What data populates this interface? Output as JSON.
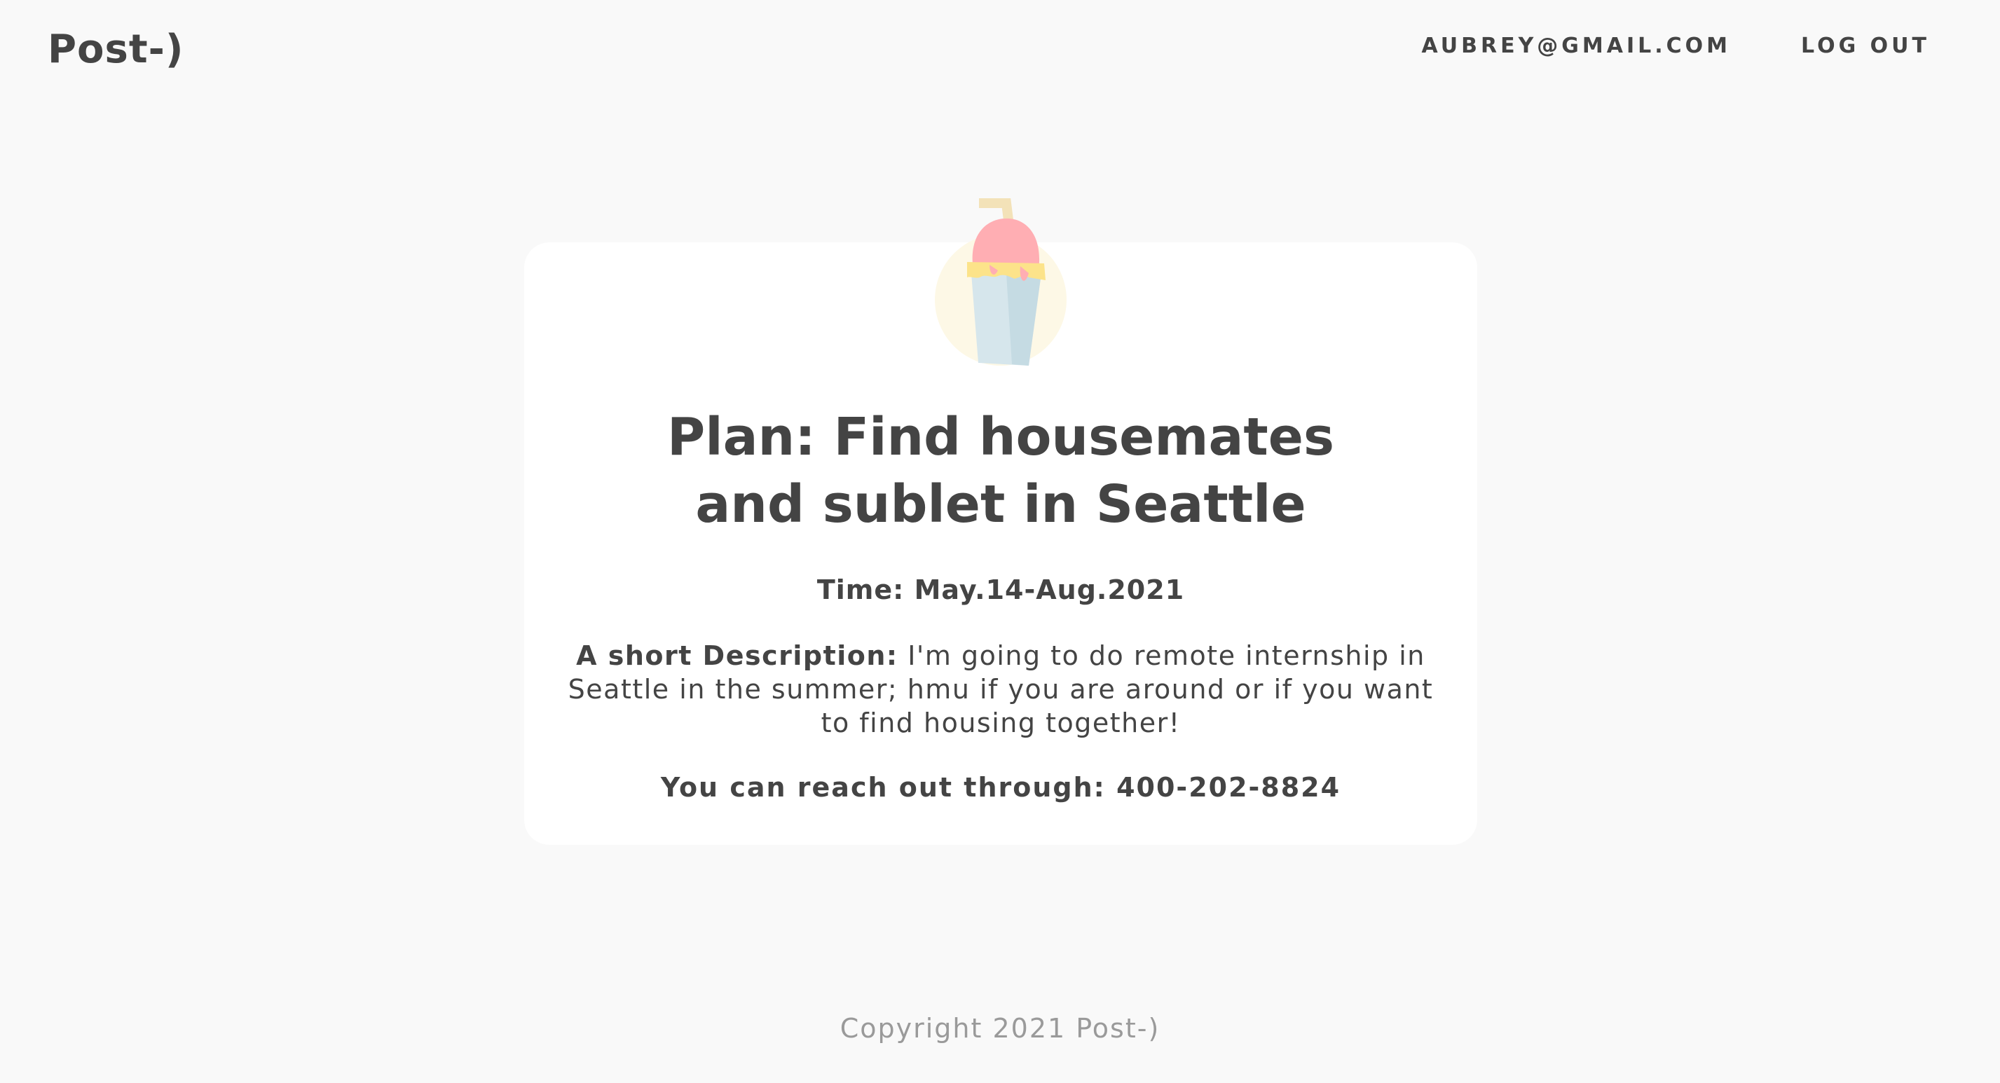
{
  "header": {
    "logo": "Post-)",
    "user_email": "AUBREY@GMAIL.COM",
    "logout_label": "LOG OUT"
  },
  "post": {
    "icon": "ice-cream-cup-icon",
    "title": "Plan: Find housemates and sublet in Seattle",
    "time_label": "Time:",
    "time_value": "May.14-Aug.2021",
    "description_label": "A short Description:",
    "description_text": "I'm going to do remote internship in Seattle in the summer; hmu if you are around or if you want to find housing together!",
    "contact_label": "You can reach out through:",
    "contact_value": "400-202-8824"
  },
  "footer": {
    "copyright": "Copyright 2021 Post-)"
  },
  "colors": {
    "background": "#f9f9f9",
    "card": "#ffffff",
    "text": "#444444",
    "footer_text": "#9a9a9a",
    "icon_pink": "#ffaeb3",
    "icon_yellow": "#fce38a",
    "icon_cup": "#d6e6ec",
    "icon_cup_shade": "#c5dbe3",
    "icon_circle": "#fdf8e6",
    "icon_straw": "#f3e2b8"
  }
}
